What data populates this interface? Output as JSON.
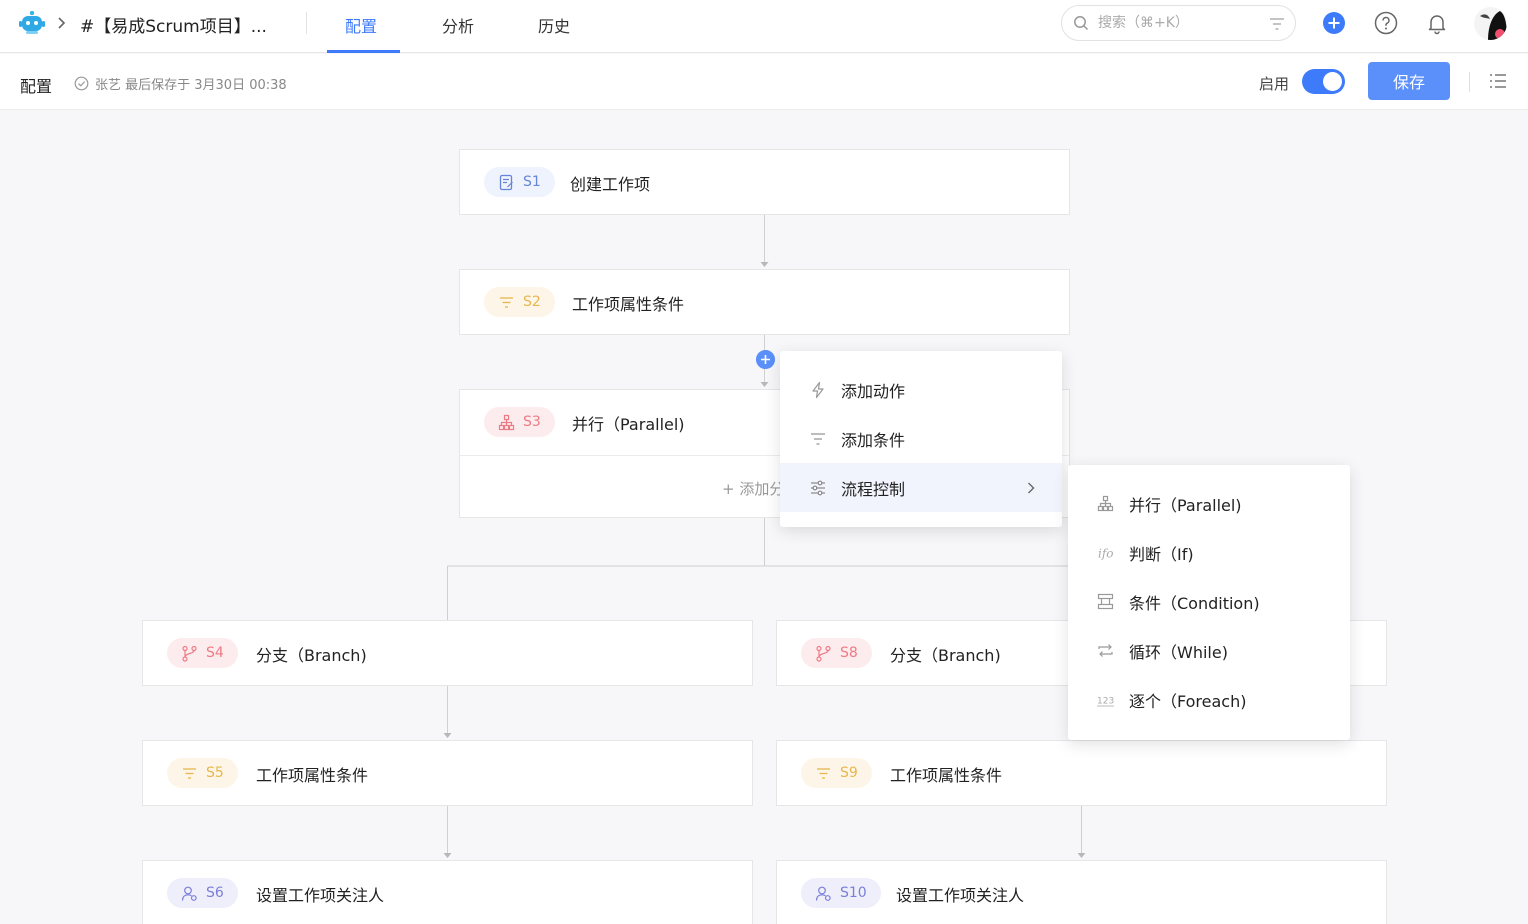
{
  "header": {
    "project_title": "#【易成Scrum项目】...",
    "tabs": [
      {
        "label": "配置",
        "active": true
      },
      {
        "label": "分析",
        "active": false
      },
      {
        "label": "历史",
        "active": false
      }
    ],
    "search_placeholder": "搜索（⌘+K）"
  },
  "subheader": {
    "title": "配置",
    "save_status": "张艺 最后保存于 3月30日 00:38",
    "enable_label": "启用",
    "enabled": true,
    "save_label": "保存"
  },
  "nodes": {
    "s1": {
      "id": "S1",
      "label": "创建工作项"
    },
    "s2": {
      "id": "S2",
      "label": "工作项属性条件"
    },
    "s3": {
      "id": "S3",
      "label": "并行（Parallel)",
      "add_label": "+ 添加分"
    },
    "s4": {
      "id": "S4",
      "label": "分支（Branch)"
    },
    "s5": {
      "id": "S5",
      "label": "工作项属性条件"
    },
    "s6": {
      "id": "S6",
      "label": "设置工作项关注人"
    },
    "s8": {
      "id": "S8",
      "label": "分支（Branch)"
    },
    "s9": {
      "id": "S9",
      "label": "工作项属性条件"
    },
    "s10": {
      "id": "S10",
      "label": "设置工作项关注人"
    }
  },
  "add_menu": {
    "items": [
      {
        "label": "添加动作",
        "icon": "bolt-icon"
      },
      {
        "label": "添加条件",
        "icon": "filter-icon"
      },
      {
        "label": "流程控制",
        "icon": "sliders-icon",
        "highlighted": true
      }
    ]
  },
  "flow_menu": {
    "items": [
      {
        "label": "并行（Parallel)",
        "icon": "hierarchy-icon"
      },
      {
        "label": "判断（If)",
        "icon": "if-icon",
        "icon_text": "ifo"
      },
      {
        "label": "条件（Condition)",
        "icon": "condition-icon"
      },
      {
        "label": "循环（While)",
        "icon": "loop-icon"
      },
      {
        "label": "逐个（Foreach)",
        "icon": "number-icon",
        "icon_text": "123"
      }
    ]
  },
  "colors": {
    "accent": "#3e7bfa",
    "save_button": "#5b8ff9"
  }
}
